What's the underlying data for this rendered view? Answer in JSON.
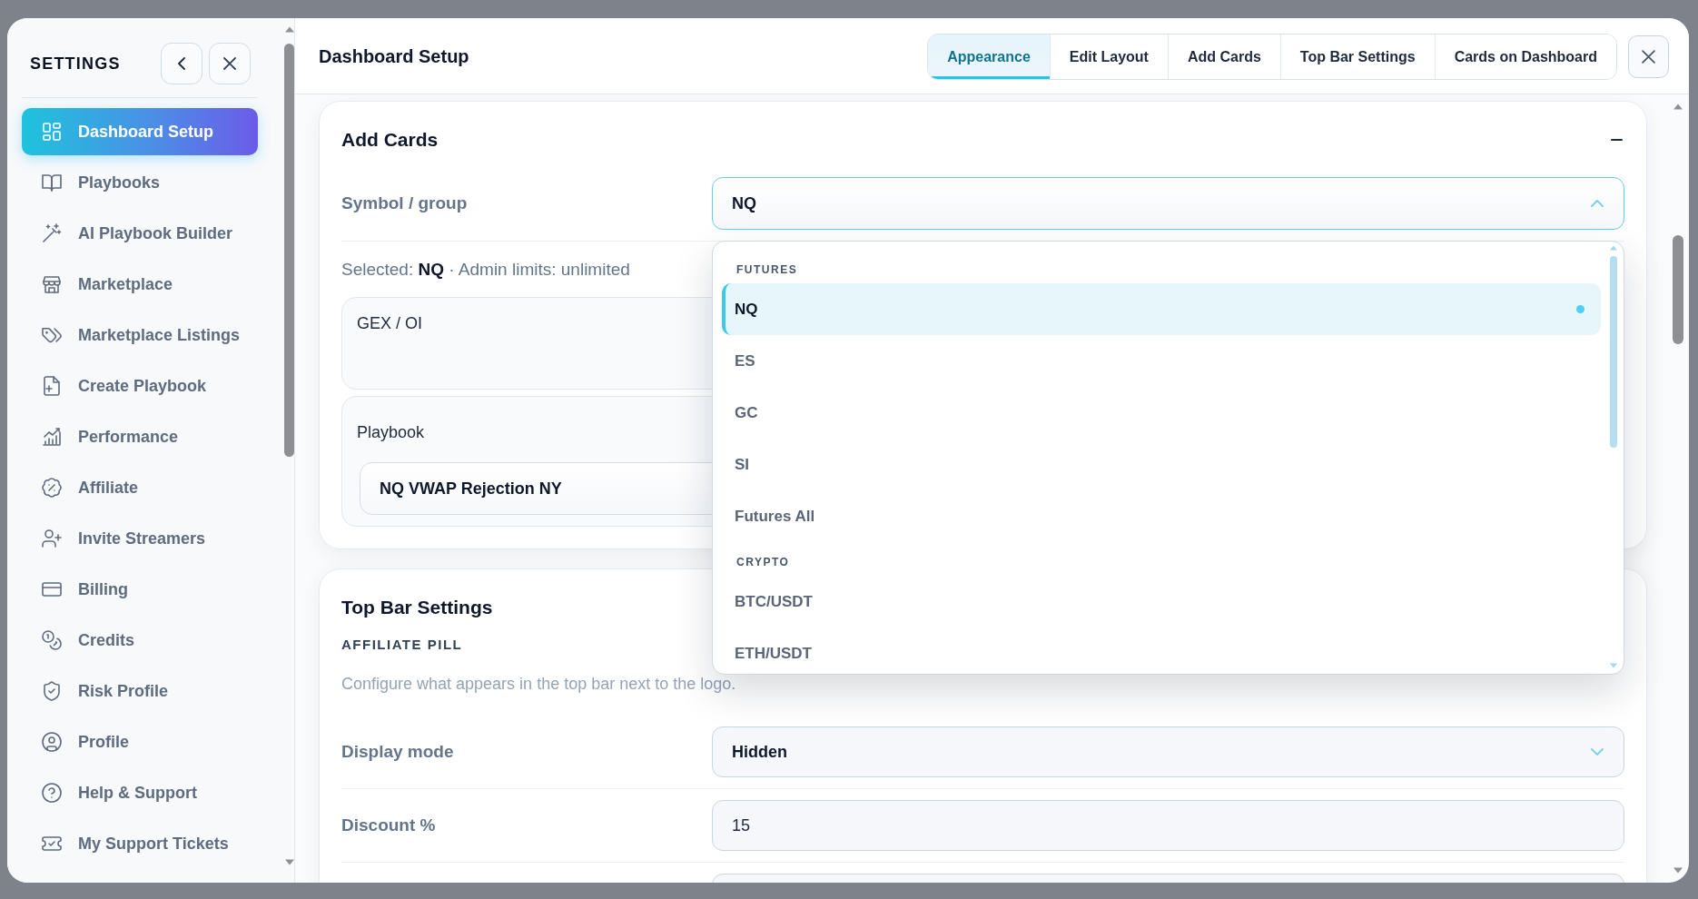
{
  "sidebar": {
    "title": "SETTINGS",
    "items": [
      {
        "label": "Dashboard Setup",
        "selected": true
      },
      {
        "label": "Playbooks",
        "selected": false
      },
      {
        "label": "AI Playbook Builder",
        "selected": false
      },
      {
        "label": "Marketplace",
        "selected": false
      },
      {
        "label": "Marketplace Listings",
        "selected": false
      },
      {
        "label": "Create Playbook",
        "selected": false
      },
      {
        "label": "Performance",
        "selected": false
      },
      {
        "label": "Affiliate",
        "selected": false
      },
      {
        "label": "Invite Streamers",
        "selected": false
      },
      {
        "label": "Billing",
        "selected": false
      },
      {
        "label": "Credits",
        "selected": false
      },
      {
        "label": "Risk Profile",
        "selected": false
      },
      {
        "label": "Profile",
        "selected": false
      },
      {
        "label": "Help & Support",
        "selected": false
      },
      {
        "label": "My Support Tickets",
        "selected": false
      }
    ]
  },
  "header": {
    "title": "Dashboard Setup",
    "tabs": [
      {
        "label": "Appearance",
        "selected": true
      },
      {
        "label": "Edit Layout",
        "selected": false
      },
      {
        "label": "Add Cards",
        "selected": false
      },
      {
        "label": "Top Bar Settings",
        "selected": false
      },
      {
        "label": "Cards on Dashboard",
        "selected": false
      }
    ]
  },
  "add_cards": {
    "title": "Add Cards",
    "expanded": true,
    "symbol_field": {
      "label": "Symbol / group",
      "value": "NQ",
      "expanded": true,
      "groups": [
        {
          "label": "FUTURES",
          "options": [
            {
              "label": "NQ",
              "selected": true
            },
            {
              "label": "ES",
              "selected": false
            },
            {
              "label": "GC",
              "selected": false
            },
            {
              "label": "SI",
              "selected": false
            },
            {
              "label": "Futures All",
              "selected": false
            }
          ]
        },
        {
          "label": "CRYPTO",
          "options": [
            {
              "label": "BTC/USDT",
              "selected": false
            },
            {
              "label": "ETH/USDT",
              "selected": false
            }
          ]
        }
      ]
    },
    "selection_note": "Selected: **NQ** · Admin limits: unlimited",
    "cards": [
      {
        "kind": "text",
        "title": "GEX / OI"
      },
      {
        "kind": "select",
        "title": "Playbook",
        "value": "NQ VWAP Rejection NY"
      }
    ]
  },
  "top_bar_settings": {
    "title": "Top Bar Settings",
    "subtitle": "AFFILIATE PILL",
    "description": "Configure what appears in the top bar next to the logo.",
    "fields": [
      {
        "kind": "select",
        "label": "Display mode",
        "value": "Hidden"
      },
      {
        "kind": "input",
        "label": "Discount %",
        "value": "15"
      },
      {
        "kind": "input"
      }
    ]
  }
}
